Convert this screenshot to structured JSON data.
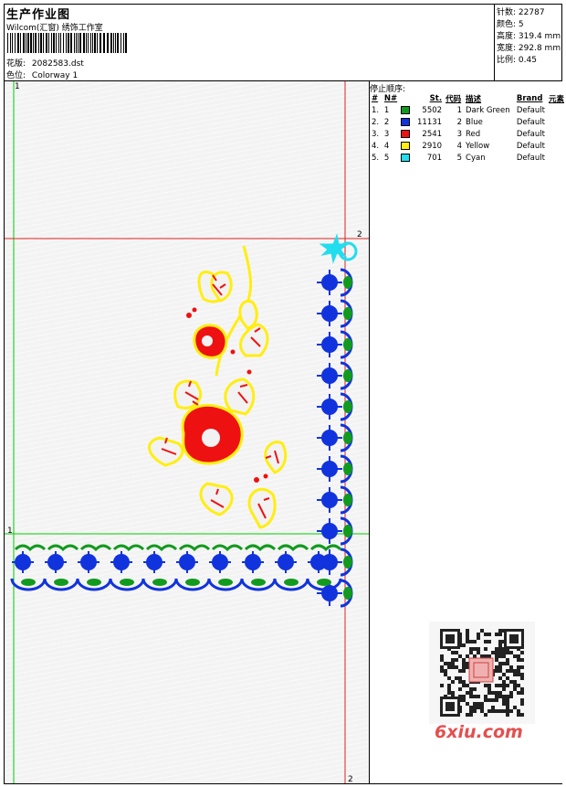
{
  "header": {
    "title": "生产作业图",
    "company": "Wilcom(汇窗) 绣饰工作室",
    "design_label": "花版:",
    "design_value": "2082583.dst",
    "colorway_label": "色位:",
    "colorway_value": "Colorway 1"
  },
  "stats": [
    {
      "label": "针数:",
      "value": "22787"
    },
    {
      "label": "颜色:",
      "value": "5"
    },
    {
      "label": "高度:",
      "value": "319.4 mm"
    },
    {
      "label": "宽度:",
      "value": "292.8 mm"
    },
    {
      "label": "比例:",
      "value": "0.45"
    }
  ],
  "stop_sequence": {
    "title": "停止顺序:",
    "columns": [
      "#",
      "N#",
      "St.",
      "代码",
      "描述",
      "Brand",
      "元素"
    ],
    "rows": [
      {
        "n": "1.",
        "nn": "1",
        "color": "#129a1e",
        "st": "5502",
        "code": "1",
        "desc": "Dark Green",
        "brand": "Default"
      },
      {
        "n": "2.",
        "nn": "2",
        "color": "#1133dd",
        "st": "11131",
        "code": "2",
        "desc": "Blue",
        "brand": "Default"
      },
      {
        "n": "3.",
        "nn": "3",
        "color": "#ee1111",
        "st": "2541",
        "code": "3",
        "desc": "Red",
        "brand": "Default"
      },
      {
        "n": "4.",
        "nn": "4",
        "color": "#ffee11",
        "st": "2910",
        "code": "4",
        "desc": "Yellow",
        "brand": "Default"
      },
      {
        "n": "5.",
        "nn": "5",
        "color": "#22ddee",
        "st": "701",
        "code": "5",
        "desc": "Cyan",
        "brand": "Default"
      }
    ]
  },
  "canvas": {
    "guide_label_1": "1",
    "guide_label_2": "2"
  },
  "watermark": {
    "logo_text": "6xiu.com"
  }
}
